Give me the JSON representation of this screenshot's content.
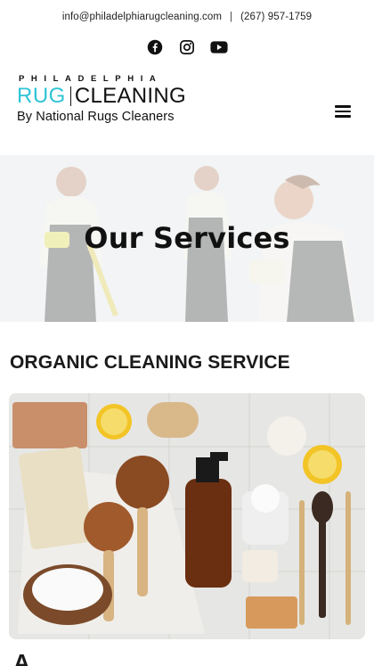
{
  "topbar": {
    "email": "info@philadelphiarugcleaning.com",
    "separator": "|",
    "phone": "(267) 957-1759"
  },
  "social": {
    "icons": [
      "facebook-icon",
      "instagram-icon",
      "youtube-icon"
    ]
  },
  "logo": {
    "top_word": "PHILADELPHIA",
    "rug": "RUG",
    "cleaning": "CLEANING",
    "tagline": "By National Rugs Cleaners",
    "accent_color": "#2ec4d6"
  },
  "menu": {
    "icon": "hamburger-menu-icon"
  },
  "hero": {
    "title": "Our Services"
  },
  "section": {
    "title": "ORGANIC CLEANING SERVICE"
  },
  "next_heading": {
    "text": "A"
  }
}
